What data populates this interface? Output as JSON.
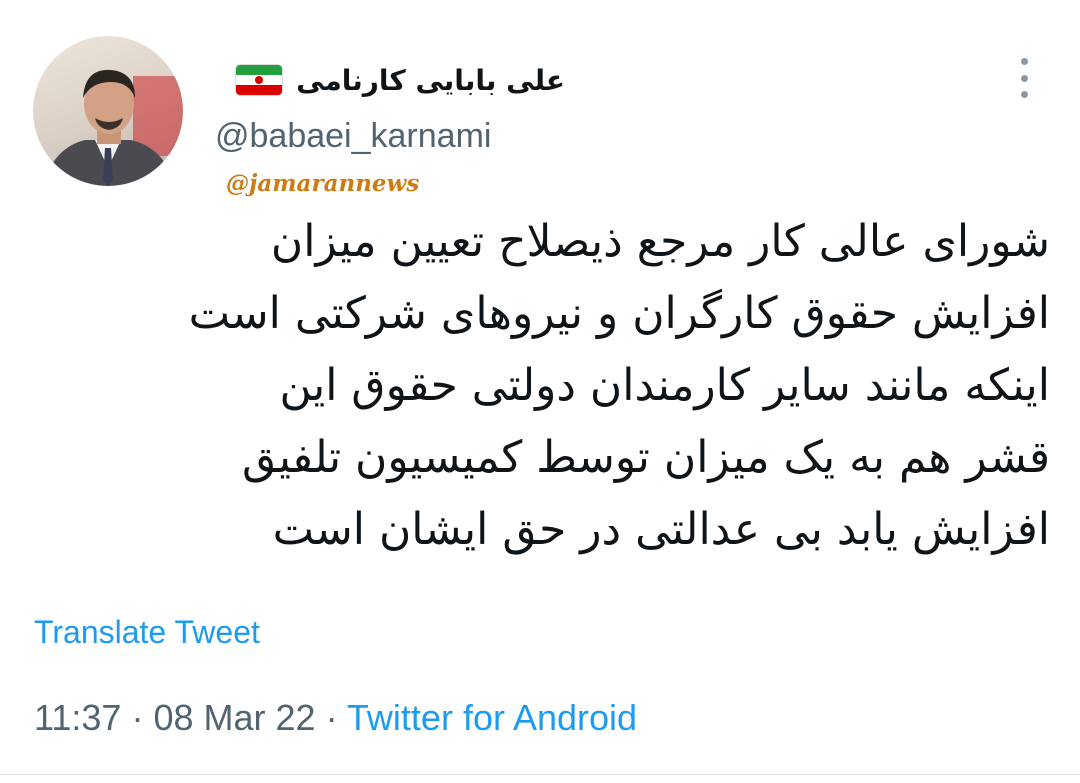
{
  "author": {
    "display_name": "علی بابایی کارنامی",
    "handle": "@babaei_karnami",
    "flag_icon": "iran-flag-icon",
    "avatar_icon": "profile-photo"
  },
  "watermark": "@jamarannews",
  "tweet": {
    "lines": [
      "شورای عالی کار مرجع ذیصلاح تعیین میزان",
      "افزایش حقوق کارگران و نیروهای شرکتی است",
      "اینکه مانند سایر کارمندان دولتی حقوق این",
      "قشر هم به یک میزان توسط کمیسیون تلفیق",
      "افزایش یابد بی عدالتی در حق ایشان است"
    ],
    "translate_label": "Translate Tweet",
    "time": "11:37",
    "date": "08 Mar 22",
    "separator": "·",
    "source": "Twitter for Android"
  },
  "colors": {
    "link": "#1d9bf0",
    "secondary_text": "#536471",
    "primary_text": "#0f1419",
    "watermark": "#d07a12"
  }
}
